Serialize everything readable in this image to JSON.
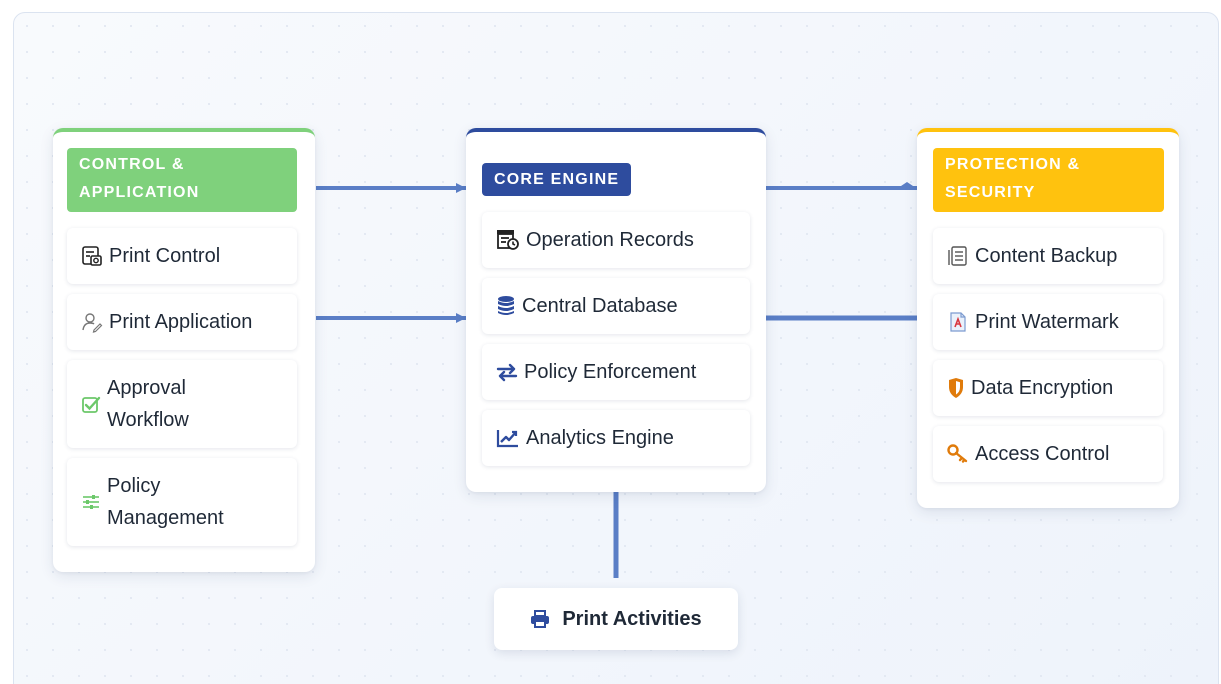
{
  "colors": {
    "control": "#7fd17c",
    "core": "#2e4c9e",
    "protection": "#ffc20e",
    "connector": "#5a7ec6"
  },
  "control": {
    "title": "CONTROL & APPLICATION",
    "items": [
      {
        "label": "Print Control",
        "icon": "print-control-icon"
      },
      {
        "label": "Print Application",
        "icon": "user-pen-icon"
      },
      {
        "label": "Approval Workflow",
        "icon": "check-square-icon"
      },
      {
        "label": "Policy Management",
        "icon": "sliders-icon"
      }
    ]
  },
  "core": {
    "title": "CORE ENGINE",
    "items": [
      {
        "label": "Operation Records",
        "icon": "records-icon"
      },
      {
        "label": "Central Database",
        "icon": "database-icon"
      },
      {
        "label": "Policy Enforcement",
        "icon": "exchange-icon"
      },
      {
        "label": "Analytics Engine",
        "icon": "chart-line-icon"
      }
    ]
  },
  "protection": {
    "title": "PROTECTION & SECURITY",
    "items": [
      {
        "label": "Content Backup",
        "icon": "document-list-icon"
      },
      {
        "label": "Print Watermark",
        "icon": "watermark-file-icon"
      },
      {
        "label": "Data Encryption",
        "icon": "shield-icon"
      },
      {
        "label": "Access Control",
        "icon": "key-icon"
      }
    ]
  },
  "activities": {
    "label": "Print Activities",
    "icon": "printer-icon"
  }
}
